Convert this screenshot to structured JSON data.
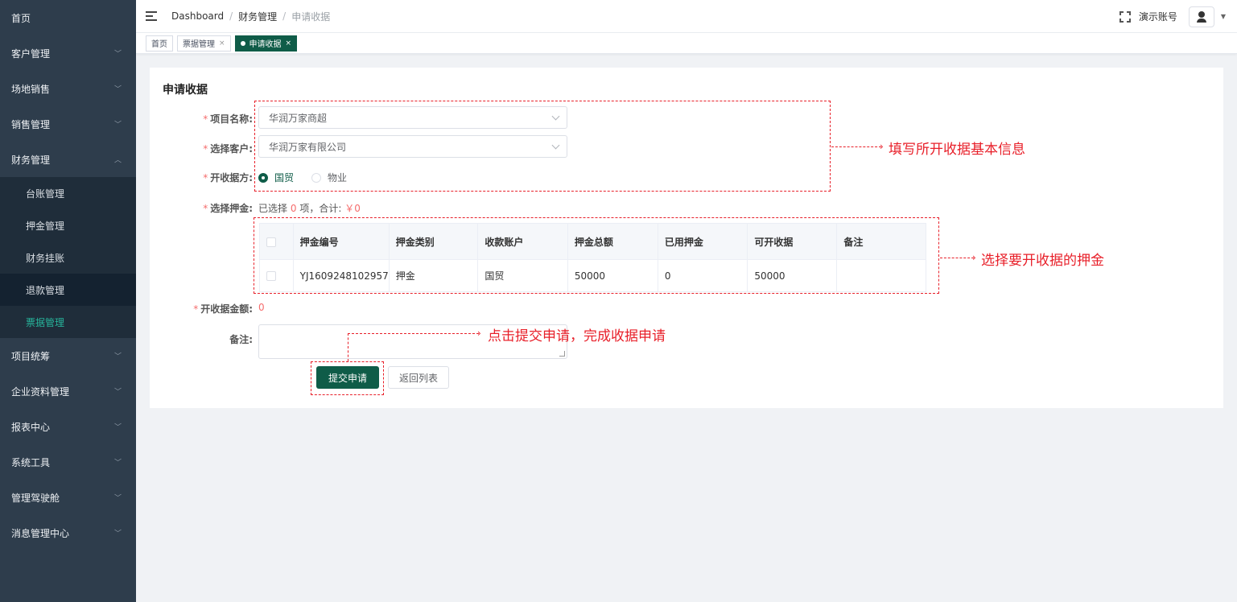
{
  "sidebar": {
    "items": [
      {
        "label": "首页",
        "chevron": false
      },
      {
        "label": "客户管理",
        "chevron": true
      },
      {
        "label": "场地销售",
        "chevron": true
      },
      {
        "label": "销售管理",
        "chevron": true
      },
      {
        "label": "财务管理",
        "chevron": true,
        "open": true
      },
      {
        "label": "项目统筹",
        "chevron": true
      },
      {
        "label": "企业资料管理",
        "chevron": true
      },
      {
        "label": "报表中心",
        "chevron": true
      },
      {
        "label": "系统工具",
        "chevron": true
      },
      {
        "label": "管理驾驶舱",
        "chevron": true
      },
      {
        "label": "消息管理中心",
        "chevron": true
      }
    ],
    "finance_sub": [
      {
        "label": "台账管理"
      },
      {
        "label": "押金管理"
      },
      {
        "label": "财务挂账"
      },
      {
        "label": "退款管理"
      },
      {
        "label": "票据管理"
      }
    ],
    "active_color": "#27b49b"
  },
  "header": {
    "breadcrumb": [
      "Dashboard",
      "财务管理",
      "申请收据"
    ],
    "separator": "/",
    "account": "演示账号"
  },
  "tags": [
    {
      "label": "首页"
    },
    {
      "label": "票据管理"
    },
    {
      "label": "申请收据"
    }
  ],
  "form": {
    "title": "申请收据",
    "project_label": "项目名称:",
    "project_value": "华润万家商超",
    "customer_label": "选择客户:",
    "customer_value": "华润万家有限公司",
    "issuer_label": "开收据方:",
    "issuer_options": [
      "国贸",
      "物业"
    ],
    "deposit_label": "选择押金:",
    "deposit_summary_prefix": "已选择",
    "deposit_count": "0",
    "deposit_summary_mid": "项，合计:",
    "deposit_total": "￥0",
    "amount_label": "开收据金额:",
    "amount_value": "0",
    "remark_label": "备注:",
    "submit_label": "提交申请",
    "back_label": "返回列表"
  },
  "table": {
    "columns": [
      "押金编号",
      "押金类别",
      "收款账户",
      "押金总额",
      "已用押金",
      "可开收据",
      "备注"
    ],
    "rows": [
      [
        "YJ1609248102957",
        "押金",
        "国贸",
        "50000",
        "0",
        "50000",
        ""
      ]
    ]
  },
  "annotations": {
    "basic_info": "填写所开收据基本信息",
    "select_deposit": "选择要开收据的押金",
    "submit": "点击提交申请，完成收据申请",
    "color": "#e8202a"
  },
  "colors": {
    "sidebar_bg": "#2e3d4c",
    "primary": "#0f5c48",
    "required": "#f56c6c"
  }
}
